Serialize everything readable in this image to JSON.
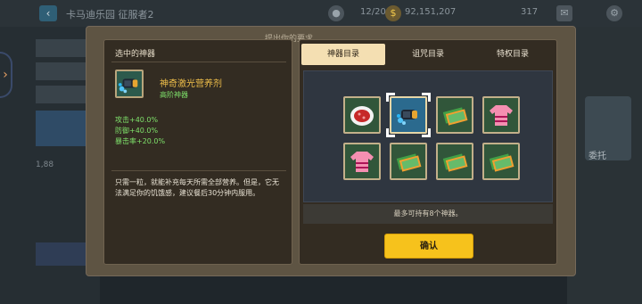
{
  "background": {
    "window_title": "卡马迪乐园",
    "subtitle": "征服者2",
    "resource_a": "12/20",
    "resource_b": "92,151,207",
    "resource_c": "317",
    "side_label": "1,88",
    "right_card_label": "委托",
    "title_hint": "提出你的要求"
  },
  "detail_panel": {
    "header": "选中的神器",
    "item_name": "神奇激光营养剂",
    "item_rarity": "高阶神器",
    "stats": [
      "攻击+40.0%",
      "防御+40.0%",
      "暴击率+20.0%"
    ],
    "description": "只需一粒，就能补充每天所需全部营养。但是，它无法满足你的饥饿感，建议餐后30分钟内服用。"
  },
  "catalog": {
    "tabs": [
      {
        "label": "神器目录",
        "active": true
      },
      {
        "label": "诅咒目录",
        "active": false
      },
      {
        "label": "特权目录",
        "active": false
      }
    ],
    "slots": [
      {
        "icon": "red-dish-icon",
        "selected": false
      },
      {
        "icon": "laser-canister-icon",
        "selected": true
      },
      {
        "icon": "cash-bundle-icon",
        "selected": false
      },
      {
        "icon": "pink-sweater-icon",
        "selected": false
      },
      {
        "icon": "pink-sweater-icon",
        "selected": false
      },
      {
        "icon": "cash-bundle-icon",
        "selected": false
      },
      {
        "icon": "cash-bundle-icon",
        "selected": false
      },
      {
        "icon": "cash-bundle-icon",
        "selected": false
      }
    ],
    "footer": "最多可持有8个神器。",
    "confirm_label": "确认"
  },
  "colors": {
    "accent_yellow": "#f6c21c",
    "stat_green": "#7ee06a",
    "name_gold": "#f0bf4a",
    "active_tab": "#f4dfb2"
  }
}
